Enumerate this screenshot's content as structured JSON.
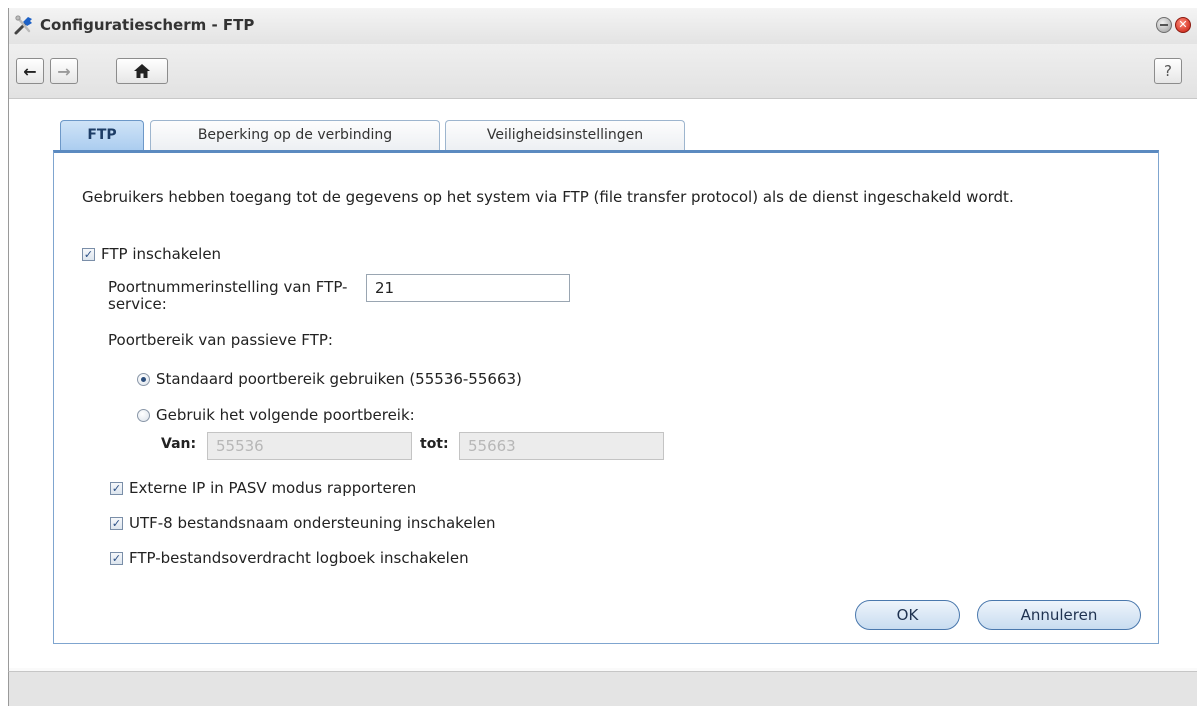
{
  "window": {
    "title": "Configuratiescherm - FTP",
    "close_glyph": "✕"
  },
  "toolbar": {
    "back_icon": "←",
    "forward_icon": "→",
    "home_icon": "⌂",
    "help_label": "?"
  },
  "tabs": [
    {
      "label": "FTP",
      "active": true
    },
    {
      "label": "Beperking op de verbinding",
      "active": false
    },
    {
      "label": "Veiligheidsinstellingen",
      "active": false
    }
  ],
  "form": {
    "description": "Gebruikers hebben toegang tot de gegevens op het system via FTP (file transfer protocol) als de dienst ingeschakeld wordt.",
    "enable_ftp": {
      "label": "FTP inschakelen",
      "checked": true
    },
    "port_label": "Poortnummerinstelling van FTP-service:",
    "port_value": "21",
    "passive_range_label": "Poortbereik van passieve FTP:",
    "radio_default": {
      "label": "Standaard poortbereik gebruiken (55536-55663)",
      "selected": true
    },
    "radio_custom": {
      "label": "Gebruik het volgende poortbereik:",
      "selected": false
    },
    "from_label": "Van:",
    "from_value": "55536",
    "to_label": "tot:",
    "to_value": "55663",
    "external_ip": {
      "label": "Externe IP in PASV modus rapporteren",
      "checked": true
    },
    "utf8": {
      "label": "UTF-8 bestandsnaam ondersteuning inschakelen",
      "checked": true
    },
    "log": {
      "label": "FTP-bestandsoverdracht logboek inschakelen",
      "checked": true
    },
    "check_glyph": "✓"
  },
  "buttons": {
    "ok": "OK",
    "cancel": "Annuleren"
  },
  "colors": {
    "accent": "#5b8ac0",
    "close_red": "#c4170a"
  }
}
